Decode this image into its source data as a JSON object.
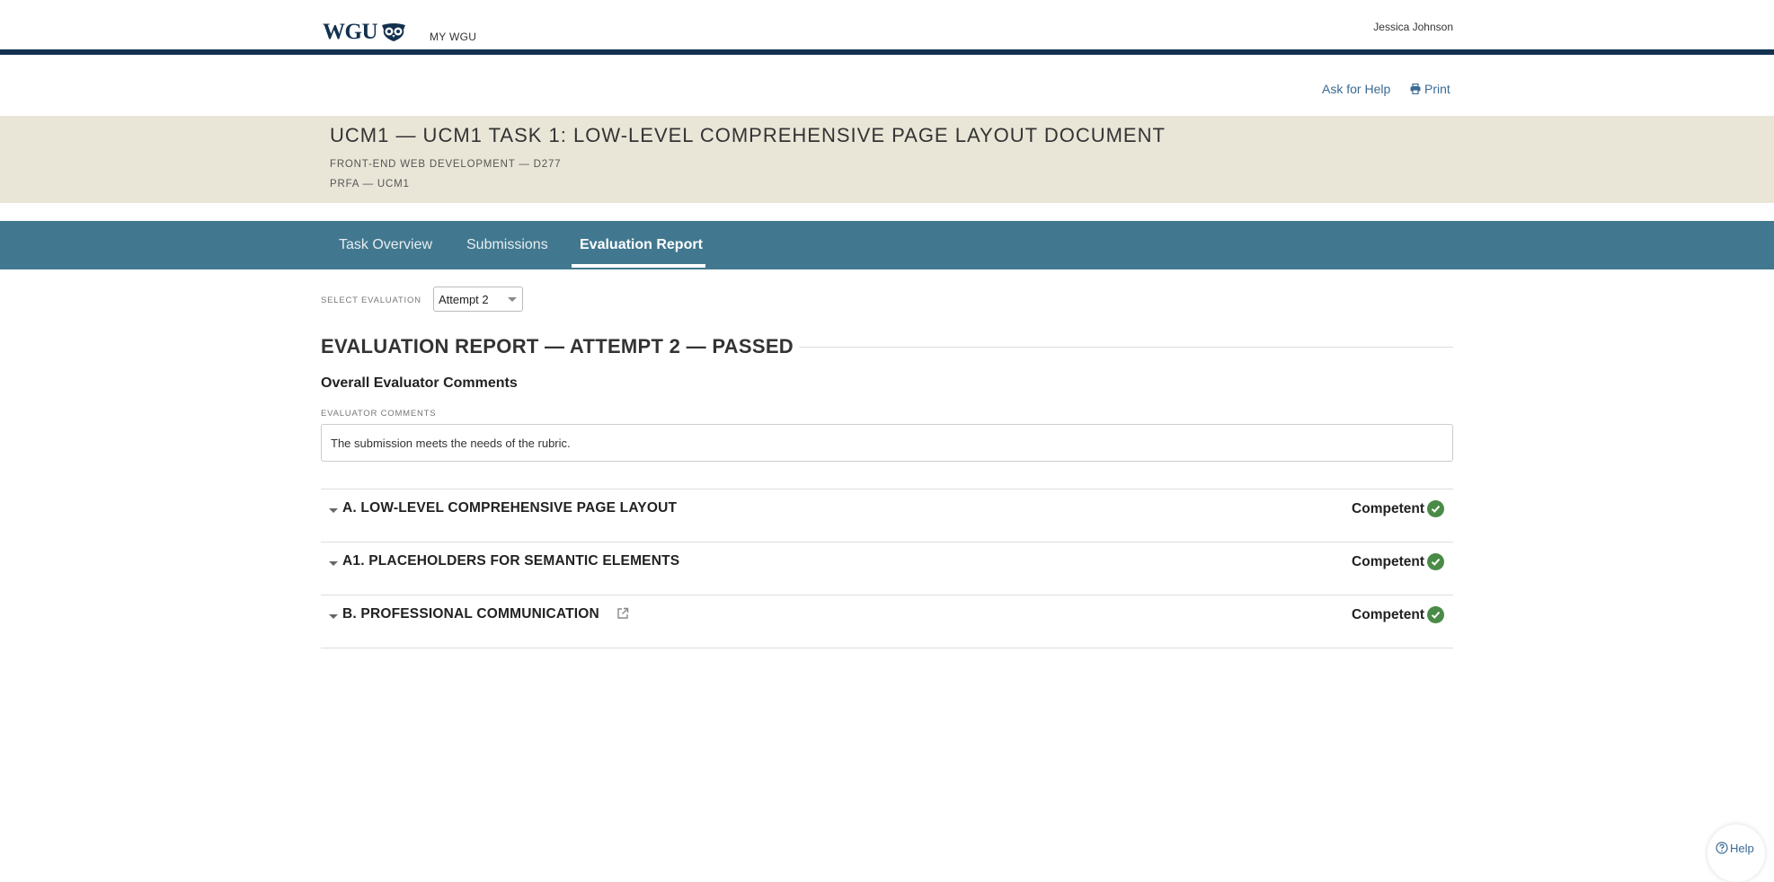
{
  "header": {
    "logo_text": "WGU",
    "nav_link": "MY WGU",
    "user_name": "Jessica Johnson"
  },
  "utility": {
    "help_label": "Ask for Help",
    "print_label": "Print"
  },
  "task": {
    "title": "UCM1 — UCM1 TASK 1: LOW-LEVEL COMPREHENSIVE PAGE LAYOUT DOCUMENT",
    "course": "FRONT-END WEB DEVELOPMENT — D277",
    "assessment": "PRFA — UCM1"
  },
  "tabs": [
    {
      "label": "Task Overview",
      "active": false
    },
    {
      "label": "Submissions",
      "active": false
    },
    {
      "label": "Evaluation Report",
      "active": true
    }
  ],
  "evaluation": {
    "select_label": "SELECT EVALUATION",
    "selected": "Attempt 2",
    "report_heading": "EVALUATION REPORT — ATTEMPT 2 — PASSED",
    "overall_title": "Overall Evaluator Comments",
    "comments_label": "EVALUATOR COMMENTS",
    "comments": "The submission meets the needs of the rubric."
  },
  "rubric": [
    {
      "title": "A. LOW-LEVEL COMPREHENSIVE PAGE LAYOUT",
      "status": "Competent",
      "has_link": false
    },
    {
      "title": "A1. PLACEHOLDERS FOR SEMANTIC ELEMENTS",
      "status": "Competent",
      "has_link": false
    },
    {
      "title": "B. PROFESSIONAL COMMUNICATION",
      "status": "Competent",
      "has_link": true
    }
  ],
  "help_bubble": {
    "label": "Help"
  },
  "colors": {
    "navy": "#13314f",
    "tab_bar": "#41788f",
    "title_band": "#e9e6d8",
    "link": "#3a6a93",
    "competent_green": "#4a8b47"
  }
}
